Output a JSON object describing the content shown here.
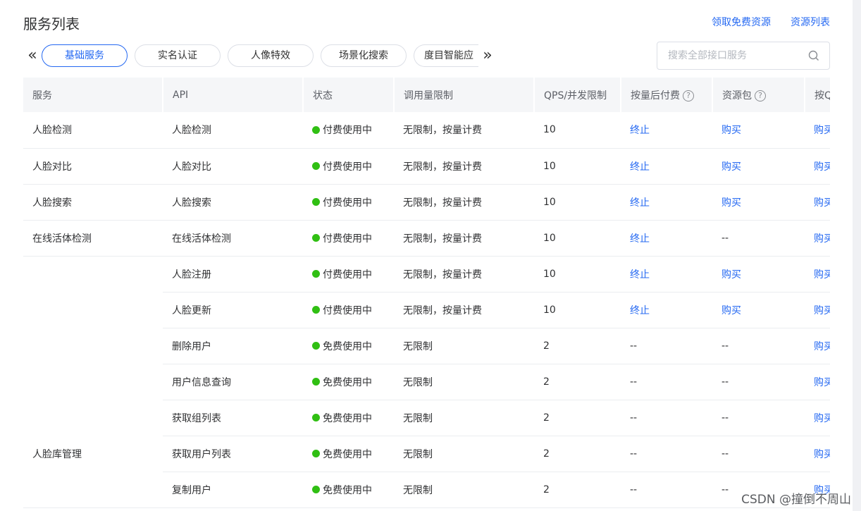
{
  "page_title": "服务列表",
  "top_links": {
    "free_resources": "领取免费资源",
    "resource_list": "资源列表"
  },
  "tabs": [
    "基础服务",
    "实名认证",
    "人像特效",
    "场景化搜索",
    "度目智能应"
  ],
  "search": {
    "placeholder": "搜索全部接口服务"
  },
  "columns": {
    "service": "服务",
    "api": "API",
    "status": "状态",
    "call_limit": "调用量限制",
    "qps": "QPS/并发限制",
    "postpaid": "按量后付费",
    "package": "资源包",
    "last": "按Q"
  },
  "rows": [
    {
      "service": "人脸检测",
      "api": "人脸检测",
      "status": "付费使用中",
      "call_limit": "无限制，按量计费",
      "qps": "10",
      "postpaid": "终止",
      "package": "购买",
      "last": "购买"
    },
    {
      "service": "人脸对比",
      "api": "人脸对比",
      "status": "付费使用中",
      "call_limit": "无限制，按量计费",
      "qps": "10",
      "postpaid": "终止",
      "package": "购买",
      "last": "购买"
    },
    {
      "service": "人脸搜索",
      "api": "人脸搜索",
      "status": "付费使用中",
      "call_limit": "无限制，按量计费",
      "qps": "10",
      "postpaid": "终止",
      "package": "购买",
      "last": "购买"
    },
    {
      "service": "在线活体检测",
      "api": "在线活体检测",
      "status": "付费使用中",
      "call_limit": "无限制，按量计费",
      "qps": "10",
      "postpaid": "终止",
      "package": "--",
      "last": "购买"
    },
    {
      "service": "",
      "api": "人脸注册",
      "status": "付费使用中",
      "call_limit": "无限制，按量计费",
      "qps": "10",
      "postpaid": "终止",
      "package": "购买",
      "last": "购买"
    },
    {
      "service": "",
      "api": "人脸更新",
      "status": "付费使用中",
      "call_limit": "无限制，按量计费",
      "qps": "10",
      "postpaid": "终止",
      "package": "购买",
      "last": "购买"
    },
    {
      "service": "",
      "api": "删除用户",
      "status": "免费使用中",
      "call_limit": "无限制",
      "qps": "2",
      "postpaid": "--",
      "package": "--",
      "last": "购买"
    },
    {
      "service": "",
      "api": "用户信息查询",
      "status": "免费使用中",
      "call_limit": "无限制",
      "qps": "2",
      "postpaid": "--",
      "package": "--",
      "last": "购买"
    },
    {
      "service": "",
      "api": "获取组列表",
      "status": "免费使用中",
      "call_limit": "无限制",
      "qps": "2",
      "postpaid": "--",
      "package": "--",
      "last": "购买"
    },
    {
      "service": "人脸库管理",
      "api": "获取用户列表",
      "status": "免费使用中",
      "call_limit": "无限制",
      "qps": "2",
      "postpaid": "--",
      "package": "--",
      "last": "购买"
    },
    {
      "service": "",
      "api": "复制用户",
      "status": "免费使用中",
      "call_limit": "无限制",
      "qps": "2",
      "postpaid": "--",
      "package": "--",
      "last": "购买"
    }
  ],
  "watermark": "CSDN @撞倒不周山",
  "colors": {
    "link": "#2468f2",
    "status_dot": "#30bf13",
    "header_bg": "#f5f6f8"
  }
}
